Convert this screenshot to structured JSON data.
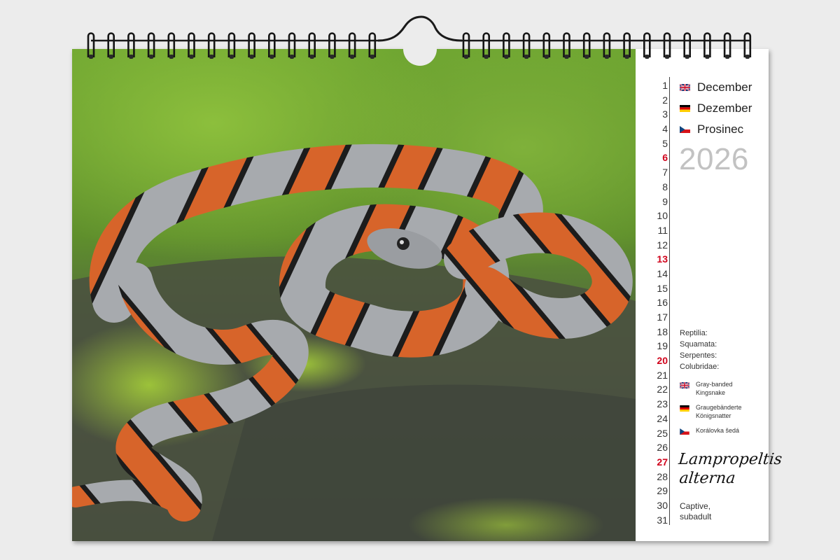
{
  "days": [
    {
      "n": "1",
      "hl": false
    },
    {
      "n": "2",
      "hl": false
    },
    {
      "n": "3",
      "hl": false
    },
    {
      "n": "4",
      "hl": false
    },
    {
      "n": "5",
      "hl": false
    },
    {
      "n": "6",
      "hl": true
    },
    {
      "n": "7",
      "hl": false
    },
    {
      "n": "8",
      "hl": false
    },
    {
      "n": "9",
      "hl": false
    },
    {
      "n": "10",
      "hl": false
    },
    {
      "n": "11",
      "hl": false
    },
    {
      "n": "12",
      "hl": false
    },
    {
      "n": "13",
      "hl": true
    },
    {
      "n": "14",
      "hl": false
    },
    {
      "n": "15",
      "hl": false
    },
    {
      "n": "16",
      "hl": false
    },
    {
      "n": "17",
      "hl": false
    },
    {
      "n": "18",
      "hl": false
    },
    {
      "n": "19",
      "hl": false
    },
    {
      "n": "20",
      "hl": true
    },
    {
      "n": "21",
      "hl": false
    },
    {
      "n": "22",
      "hl": false
    },
    {
      "n": "23",
      "hl": false
    },
    {
      "n": "24",
      "hl": false
    },
    {
      "n": "25",
      "hl": false
    },
    {
      "n": "26",
      "hl": false
    },
    {
      "n": "27",
      "hl": true
    },
    {
      "n": "28",
      "hl": false
    },
    {
      "n": "29",
      "hl": false
    },
    {
      "n": "30",
      "hl": false
    },
    {
      "n": "31",
      "hl": false
    }
  ],
  "months": [
    {
      "flag": "uk-flag-icon",
      "name": "December"
    },
    {
      "flag": "de-flag-icon",
      "name": "Dezember"
    },
    {
      "flag": "cz-flag-icon",
      "name": "Prosinec"
    }
  ],
  "year": "2026",
  "taxonomy": [
    "Reptilia:",
    "Squamata:",
    "Serpentes:",
    "Colubridae:"
  ],
  "common_names": [
    {
      "flag": "uk-flag-icon",
      "name": "Gray-banded Kingsnake"
    },
    {
      "flag": "de-flag-icon",
      "name": "Graugebänderte Königsnatter"
    },
    {
      "flag": "cz-flag-icon",
      "name": "Korálovka šedá"
    }
  ],
  "latin_name": {
    "line1": "Lampropeltis",
    "line2": "alterna"
  },
  "note": {
    "line1": "Captive,",
    "line2": "subadult"
  },
  "colors": {
    "highlight": "#d0021b",
    "year": "#c2c2c2",
    "snake_orange": "#d7642a",
    "snake_gray": "#a9acaf"
  }
}
